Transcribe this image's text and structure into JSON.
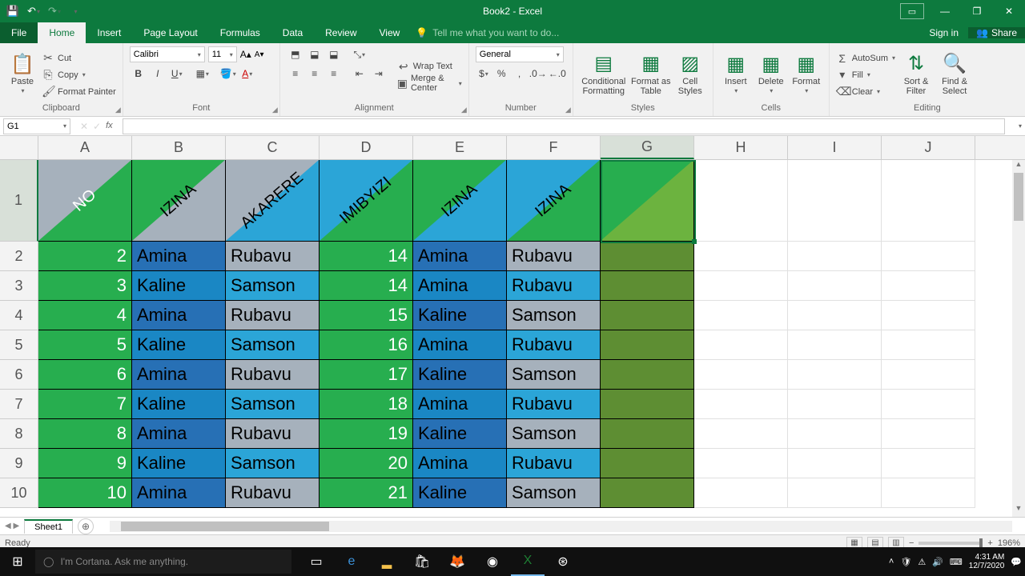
{
  "titlebar": {
    "title": "Book2 - Excel"
  },
  "tabs": {
    "file": "File",
    "items": [
      "Home",
      "Insert",
      "Page Layout",
      "Formulas",
      "Data",
      "Review",
      "View"
    ],
    "active": "Home",
    "tell_me": "Tell me what you want to do...",
    "sign_in": "Sign in",
    "share": "Share"
  },
  "ribbon": {
    "clipboard": {
      "label": "Clipboard",
      "paste": "Paste",
      "cut": "Cut",
      "copy": "Copy",
      "painter": "Format Painter"
    },
    "font": {
      "label": "Font",
      "name": "Calibri",
      "size": "11"
    },
    "alignment": {
      "label": "Alignment",
      "wrap": "Wrap Text",
      "merge": "Merge & Center"
    },
    "number": {
      "label": "Number",
      "format": "General"
    },
    "styles": {
      "label": "Styles",
      "cond": "Conditional Formatting",
      "table": "Format as Table",
      "cell": "Cell Styles"
    },
    "cells": {
      "label": "Cells",
      "insert": "Insert",
      "delete": "Delete",
      "format": "Format"
    },
    "editing": {
      "label": "Editing",
      "autosum": "AutoSum",
      "fill": "Fill",
      "clear": "Clear",
      "sort": "Sort & Filter",
      "find": "Find & Select"
    }
  },
  "namebox": "G1",
  "columns": [
    "A",
    "B",
    "C",
    "D",
    "E",
    "F",
    "G",
    "H",
    "I",
    "J"
  ],
  "active_col": "G",
  "active_row": 1,
  "header_row": {
    "cells": [
      {
        "text": "NO",
        "tri_top": "c-grey",
        "tri_bot": "c-green",
        "txt": "txt-white"
      },
      {
        "text": "IZINA",
        "tri_top": "c-green",
        "tri_bot": "c-grey",
        "txt": ""
      },
      {
        "text": "AKARERE",
        "tri_top": "c-grey",
        "tri_bot": "c-blue-l",
        "txt": ""
      },
      {
        "text": "IMIBYIZI",
        "tri_top": "c-blue-l",
        "tri_bot": "c-green",
        "txt": ""
      },
      {
        "text": "IZINA",
        "tri_top": "c-green",
        "tri_bot": "c-blue-l",
        "txt": ""
      },
      {
        "text": "IZINA",
        "tri_top": "c-blue-l",
        "tri_bot": "c-green",
        "txt": ""
      },
      {
        "text": "",
        "tri_top": "c-green",
        "tri_bot": "c-lime",
        "txt": ""
      }
    ]
  },
  "data": [
    {
      "a": "2",
      "b": "Amina",
      "c": "Rubavu",
      "d": "14",
      "e": "Amina",
      "f": "Rubavu"
    },
    {
      "a": "3",
      "b": "Kaline",
      "c": "Samson",
      "d": "14",
      "e": "Amina",
      "f": "Rubavu"
    },
    {
      "a": "4",
      "b": "Amina",
      "c": "Rubavu",
      "d": "15",
      "e": "Kaline",
      "f": "Samson"
    },
    {
      "a": "5",
      "b": "Kaline",
      "c": "Samson",
      "d": "16",
      "e": "Amina",
      "f": "Rubavu"
    },
    {
      "a": "6",
      "b": "Amina",
      "c": "Rubavu",
      "d": "17",
      "e": "Kaline",
      "f": "Samson"
    },
    {
      "a": "7",
      "b": "Kaline",
      "c": "Samson",
      "d": "18",
      "e": "Amina",
      "f": "Rubavu"
    },
    {
      "a": "8",
      "b": "Amina",
      "c": "Rubavu",
      "d": "19",
      "e": "Kaline",
      "f": "Samson"
    },
    {
      "a": "9",
      "b": "Kaline",
      "c": "Samson",
      "d": "20",
      "e": "Amina",
      "f": "Rubavu"
    },
    {
      "a": "10",
      "b": "Amina",
      "c": "Rubavu",
      "d": "21",
      "e": "Kaline",
      "f": "Samson"
    }
  ],
  "sheet": {
    "name": "Sheet1"
  },
  "status": {
    "ready": "Ready",
    "zoom": "196%"
  },
  "taskbar": {
    "search": "I'm Cortana. Ask me anything.",
    "time": "4:31 AM",
    "date": "12/7/2020"
  }
}
